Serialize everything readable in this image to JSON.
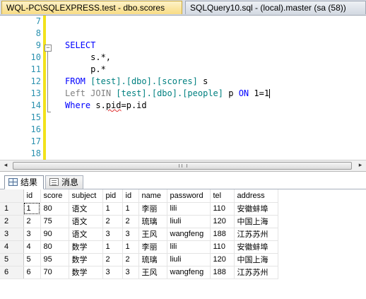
{
  "tabs": {
    "active": "WQL-PC\\SQLEXPRESS.test - dbo.scores",
    "inactive": "SQLQuery10.sql - (local).master (sa (58))"
  },
  "editor": {
    "line_numbers": [
      "7",
      "8",
      "9",
      "10",
      "11",
      "12",
      "13",
      "14",
      "15",
      "16",
      "17",
      "18"
    ],
    "code": {
      "l9_select": "SELECT",
      "l10_text": "s.*,",
      "l11_text": "p.*",
      "l12_from": "FROM",
      "l12_obj": "[test].[dbo].[scores]",
      "l12_alias": "s",
      "l13_left": "Left",
      "l13_join": "JOIN",
      "l13_obj": "[test].[dbo].[people]",
      "l13_alias": "p",
      "l13_on": "ON",
      "l13_cond": "1=1",
      "l14_where": "Where",
      "l14_s": "s.",
      "l14_pid": "pid",
      "l14_rest": "=p.id"
    },
    "fold_toggle": "−"
  },
  "scrollbar": {
    "left_arrow": "◂",
    "right_arrow": "▸"
  },
  "results": {
    "tab_results": "结果",
    "tab_messages": "消息",
    "columns": [
      "id",
      "score",
      "subject",
      "pid",
      "id",
      "name",
      "password",
      "tel",
      "address"
    ],
    "rows": [
      {
        "n": "1",
        "cells": [
          "1",
          "80",
          "语文",
          "1",
          "1",
          "李丽",
          "lili",
          "110",
          "安徽蚌埠"
        ]
      },
      {
        "n": "2",
        "cells": [
          "2",
          "75",
          "语文",
          "2",
          "2",
          "琉璃",
          "liuli",
          "120",
          "中国上海"
        ]
      },
      {
        "n": "3",
        "cells": [
          "3",
          "90",
          "语文",
          "3",
          "3",
          "王风",
          "wangfeng",
          "188",
          "江苏苏州"
        ]
      },
      {
        "n": "4",
        "cells": [
          "4",
          "80",
          "数学",
          "1",
          "1",
          "李丽",
          "lili",
          "110",
          "安徽蚌埠"
        ]
      },
      {
        "n": "5",
        "cells": [
          "5",
          "95",
          "数学",
          "2",
          "2",
          "琉璃",
          "liuli",
          "120",
          "中国上海"
        ]
      },
      {
        "n": "6",
        "cells": [
          "6",
          "70",
          "数学",
          "3",
          "3",
          "王风",
          "wangfeng",
          "188",
          "江苏苏州"
        ]
      }
    ]
  }
}
